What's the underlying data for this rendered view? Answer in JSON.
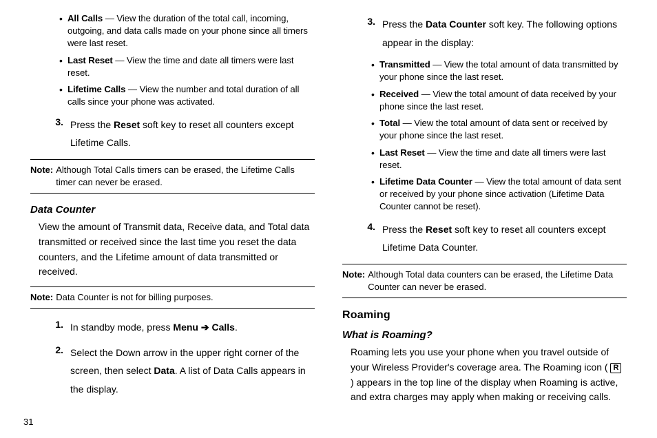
{
  "page_number": "31",
  "left": {
    "bullets_top": [
      {
        "term": "All Calls",
        "desc": " — View the duration of the total call, incoming, outgoing, and data calls made on your phone since all timers were last reset."
      },
      {
        "term": "Last Reset",
        "desc": " — View the time and date all timers were last reset."
      },
      {
        "term": "Lifetime Calls",
        "desc": " — View the number and total duration of all calls since your phone was activated."
      }
    ],
    "step3": {
      "num": "3.",
      "pre": "Press the ",
      "bold": "Reset",
      "post": " soft key to reset all counters except Lifetime Calls."
    },
    "note1": {
      "label": "Note:",
      "text": " Although Total Calls timers can be erased, the Lifetime Calls timer can never be erased."
    },
    "heading_data_counter": "Data Counter",
    "data_counter_intro": "View the amount of Transmit data, Receive data, and Total data transmitted or received since the last time you reset the data counters, and the Lifetime amount of data transmitted or received.",
    "note2": {
      "label": "Note:",
      "text": " Data Counter is not for billing purposes."
    },
    "step1": {
      "num": "1.",
      "pre": "In standby mode, press ",
      "menu": "Menu",
      "arrow": " ➔ ",
      "calls": "Calls",
      "post": "."
    },
    "step2": {
      "num": "2.",
      "pre": "Select the Down arrow in the upper right corner of the screen, then select ",
      "bold": "Data",
      "post": ". A list of Data Calls appears in the display."
    }
  },
  "right": {
    "step3": {
      "num": "3.",
      "pre": "Press the ",
      "bold": "Data Counter",
      "post": " soft key. The following options appear in the display:"
    },
    "bullets": [
      {
        "term": "Transmitted",
        "desc": " — View the total amount of data transmitted by your phone since the last reset."
      },
      {
        "term": "Received",
        "desc": " — View the total amount of data received by your phone since the last reset."
      },
      {
        "term": "Total",
        "desc": " — View the total amount of data sent or received by your phone since the last reset."
      },
      {
        "term": "Last Reset",
        "desc": " — View the time and date all timers were last reset."
      },
      {
        "term": "Lifetime Data Counter",
        "desc": " — View the total amount of data sent or received by your phone since activation (Lifetime Data Counter cannot be reset)."
      }
    ],
    "step4": {
      "num": "4.",
      "pre": "Press the ",
      "bold": "Reset",
      "post": " soft key to reset all counters except Lifetime Data Counter."
    },
    "note3": {
      "label": "Note:",
      "text": " Although Total data counters can be erased, the Lifetime Data Counter can never be erased."
    },
    "heading_roaming": "Roaming",
    "heading_what_is": "What is Roaming?",
    "roaming_pre": "Roaming lets you use your phone when you travel outside of your Wireless Provider's coverage area. The Roaming icon (",
    "roaming_icon": "R",
    "roaming_post": ") appears in the top line of the display when Roaming is active, and extra charges may apply when making or receiving calls."
  }
}
